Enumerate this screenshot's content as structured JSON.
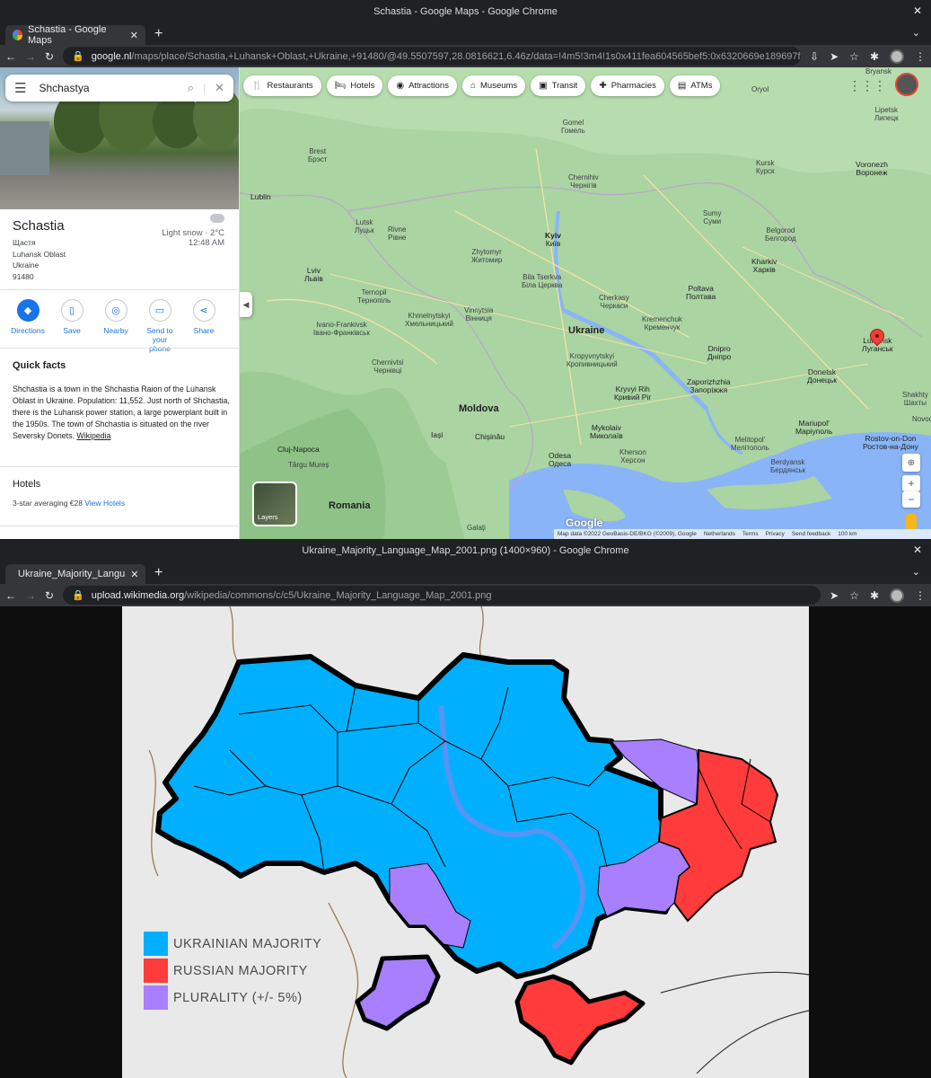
{
  "window1": {
    "title": "Schastia - Google Maps - Google Chrome",
    "tab_title": "Schastia - Google Maps",
    "url_host": "google.nl",
    "url_path": "/maps/place/Schastia,+Luhansk+Oblast,+Ukraine,+91480/@49.5507597,28.0816621,6.46z/data=!4m5!3m4!1s0x411fea604565bef5:0x6320669e189697f2!8m2!3d48.737247!4d39.2311..."
  },
  "maps": {
    "search_value": "Shchastya",
    "place": {
      "name": "Schastia",
      "native_name": "Щастя",
      "oblast": "Luhansk Oblast",
      "country": "Ukraine",
      "postal": "91480"
    },
    "weather": {
      "condition": "Light snow · 2°C",
      "time": "12:48 AM"
    },
    "actions": [
      {
        "label": "Directions",
        "icon": "directions-icon",
        "glyph": "◆"
      },
      {
        "label": "Save",
        "icon": "bookmark-icon",
        "glyph": "▯"
      },
      {
        "label": "Nearby",
        "icon": "nearby-icon",
        "glyph": "◎"
      },
      {
        "label": "Send to your phone",
        "icon": "phone-icon",
        "glyph": "▭"
      },
      {
        "label": "Share",
        "icon": "share-icon",
        "glyph": "⋖"
      }
    ],
    "quick_facts_title": "Quick facts",
    "quick_facts_text": "Shchastia is a town in the Shchastia Raion of the Luhansk Oblast in Ukraine. Population: 11,552. Just north of Shchastia, there is the Luhansk power station, a large powerplant built in the 1950s. The town of Shchastia is situated on the river Seversky Donets.",
    "quick_facts_link": "Wikipedia",
    "hotels_title": "Hotels",
    "hotels_summary": "3-star averaging €28",
    "hotels_link": "View Hotels",
    "chips": [
      {
        "label": "Restaurants",
        "glyph": "🍴"
      },
      {
        "label": "Hotels",
        "glyph": "🛏"
      },
      {
        "label": "Attractions",
        "glyph": "◉"
      },
      {
        "label": "Museums",
        "glyph": "⌂"
      },
      {
        "label": "Transit",
        "glyph": "▣"
      },
      {
        "label": "Pharmacies",
        "glyph": "✚"
      },
      {
        "label": "ATMs",
        "glyph": "▤"
      }
    ],
    "layers_label": "Layers",
    "google_logo": "Google",
    "footer": [
      "Map data ©2022 GeoBasis-DE/BKG (©2009), Google",
      "Netherlands",
      "Terms",
      "Privacy",
      "Send feedback",
      "100 km"
    ],
    "labels": {
      "ukraine": "Ukraine",
      "moldova": "Moldova",
      "romania": "Romania",
      "kyiv": "Kyiv",
      "kyiv_native": "Київ",
      "kharkiv": "Kharkiv",
      "kharkiv_native": "Харків",
      "lviv": "Lviv",
      "lviv_native": "Львів",
      "dnipro": "Dnipro",
      "dnipro_native": "Дніпро",
      "odesa": "Odesa",
      "odesa_native": "Одеса",
      "chisinau": "Chișinău",
      "poltava": "Poltava",
      "poltava_native": "Полтава",
      "zaporizhzhia": "Zaporizhzhia",
      "zaporizhzhia_native": "Запоріжжя",
      "kryvyi": "Kryvyi Rih",
      "kryvyi_native": "Кривий Ріг",
      "mykolaiv": "Mykolaiv",
      "mykolaiv_native": "Миколаїв",
      "donetsk": "Donetsk",
      "donetsk_native": "Донецьк",
      "mariupol": "Mariupol'",
      "mariupol_native": "Маріуполь",
      "luhansk": "Luhansk",
      "luhansk_native": "Луганськ",
      "rostov": "Rostov-on-Don",
      "rostov_native": "Ростов-на-Дону",
      "voronezh": "Voronezh",
      "voronezh_native": "Воронеж",
      "kursk": "Kursk",
      "kursk_native": "Курск",
      "belgorod": "Belgorod",
      "belgorod_native": "Белгород",
      "sumy": "Sumy",
      "sumy_native": "Суми",
      "chernihiv": "Chernihiv",
      "chernihiv_native": "Чернігів",
      "gomel": "Gomel",
      "gomel_native": "Гомель",
      "brest": "Brest",
      "brest_native": "Брэст",
      "lublin": "Lublin",
      "lutsk": "Lutsk",
      "lutsk_native": "Луцьк",
      "rivne": "Rivne",
      "rivne_native": "Рівне",
      "zhytomyr": "Zhytomyr",
      "zhytomyr_native": "Житомир",
      "ternopil": "Ternopil",
      "ternopil_native": "Тернопіль",
      "khmelnytskyi": "Khmelnytskyi",
      "khmelnytskyi_native": "Хмельницький",
      "vinnytsia": "Vinnytsia",
      "vinnytsia_native": "Вінниця",
      "bila": "Bila Tserkva",
      "bila_native": "Біла Церква",
      "cherkasy": "Cherkasy",
      "cherkasy_native": "Черкаси",
      "kremenchuk": "Kremenchuk",
      "kremenchuk_native": "Кременчук",
      "kropyvnytskyi": "Kropyvnytskyi",
      "kropyvnytskyi_native": "Кропивницький",
      "ivano": "Ivano-Frankivsk",
      "ivano_native": "Івано-Франківськ",
      "chernivtsi": "Chernivtsi",
      "chernivtsi_native": "Чернівці",
      "iasi": "Iași",
      "cluj": "Cluj-Napoca",
      "targu": "Târgu Mureș",
      "kherson": "Kherson",
      "kherson_native": "Херсон",
      "melitopol": "Melitopol'",
      "melitopol_native": "Мелітополь",
      "berdyansk": "Berdyansk",
      "berdyansk_native": "Бердянськ",
      "shakhty": "Shakhty",
      "shakhty_native": "Шахты",
      "bryansk": "Bryansk",
      "oryol": "Oryol",
      "lipetsk": "Lipetsk",
      "lipetsk_native": "Липецк",
      "novoch": "Novoch",
      "galati": "Galați"
    }
  },
  "window2": {
    "title": "Ukraine_Majority_Language_Map_2001.png (1400×960) - Google Chrome",
    "tab_title": "Ukraine_Majority_Langu",
    "url_host": "upload.wikimedia.org",
    "url_path": "/wikipedia/commons/c/c5/Ukraine_Majority_Language_Map_2001.png"
  },
  "legend": [
    {
      "label": "UKRAINIAN MAJORITY",
      "color": "#00b0ff"
    },
    {
      "label": "RUSSIAN MAJORITY",
      "color": "#ff3b3b"
    },
    {
      "label": "PLURALITY (+/- 5%)",
      "color": "#a77fff"
    }
  ],
  "colors": {
    "ukrainian": "#00b0ff",
    "russian": "#ff3b3b",
    "plurality": "#a77fff",
    "map_bg": "#a8d3a0",
    "water": "#8ab4f8",
    "accent": "#1a73e8"
  }
}
